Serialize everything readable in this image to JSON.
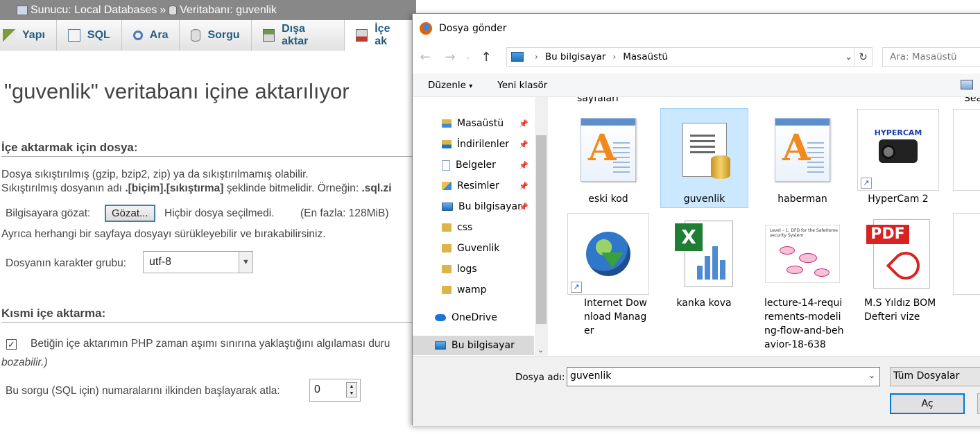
{
  "pma": {
    "breadcrumb": {
      "server": "Sunucu: Local Databases",
      "separator": "»",
      "database": "Veritabanı: guvenlik"
    },
    "tabs": [
      {
        "label": "Yapı",
        "icon": "structure-icon"
      },
      {
        "label": "SQL",
        "icon": "sql-icon"
      },
      {
        "label": "Ara",
        "icon": "search-icon"
      },
      {
        "label": "Sorgu",
        "icon": "query-icon"
      },
      {
        "label": "Dışa aktar",
        "icon": "export-icon"
      },
      {
        "label": "İçe ak",
        "icon": "import-icon"
      }
    ],
    "page_title": "\"guvenlik\" veritabanı içine aktarılıyor",
    "section_file": {
      "heading": "İçe aktarmak için dosya:",
      "line1": "Dosya sıkıştırılmış (gzip, bzip2, zip) ya da sıkıştırılmamış olabilir.",
      "line2_pre": "Sıkıştırılmış dosyanın adı ",
      "line2_bold": ".[biçim].[sıkıştırma]",
      "line2_post": " şeklinde bitmelidir. Örneğin: ",
      "line2_example": ".sql.zi",
      "browse_label": "Bilgisayara gözat:",
      "browse_button": "Gözat...",
      "no_file": "Hiçbir dosya seçilmedi.",
      "max_size": "(En fazla: 128MiB)",
      "drag_hint": "Ayrıca herhangi bir sayfaya dosyayı sürükleyebilir ve bırakabilirsiniz.",
      "charset_label": "Dosyanın karakter grubu:",
      "charset_value": "utf-8"
    },
    "section_partial": {
      "heading": "Kısmi içe aktarma:",
      "checkbox_label": "Betiğin içe aktarımın PHP zaman aşımı sınırına yaklaştığını algılaması duru",
      "checkbox_cont": "bozabilir.)",
      "skip_label": "Bu sorgu (SQL için) numaralarını ilkinden başlayarak atla:",
      "skip_value": "0"
    }
  },
  "dialog": {
    "title": "Dosya gönder",
    "address": [
      "Bu bilgisayar",
      "Masaüstü"
    ],
    "search_placeholder": "Ara: Masaüstü",
    "commands": {
      "organize": "Düzenle",
      "organize_arrow": "▾",
      "new_folder": "Yeni klasör"
    },
    "tree": [
      {
        "label": "Masaüstü",
        "icon": "desktop-folder-icon",
        "pinned": true
      },
      {
        "label": "İndirilenler",
        "icon": "downloads-folder-icon",
        "pinned": true
      },
      {
        "label": "Belgeler",
        "icon": "documents-folder-icon",
        "pinned": true
      },
      {
        "label": "Resimler",
        "icon": "pictures-folder-icon",
        "pinned": true
      },
      {
        "label": "Bu bilgisayar",
        "icon": "computer-icon",
        "pinned": true
      },
      {
        "label": "css",
        "icon": "folder-icon"
      },
      {
        "label": "Guvenlik",
        "icon": "folder-icon"
      },
      {
        "label": "logs",
        "icon": "folder-icon"
      },
      {
        "label": "wamp",
        "icon": "folder-icon"
      },
      {
        "label": "OneDrive",
        "icon": "onedrive-icon"
      },
      {
        "label": "Bu bilgisayar",
        "icon": "computer-icon",
        "selected": true
      }
    ],
    "files_partial_top": [
      "sayfaları",
      "Sear"
    ],
    "files": [
      {
        "name": "eski kod",
        "icon": "text-document-icon"
      },
      {
        "name": "guvenlik",
        "icon": "sql-file-icon",
        "selected": true
      },
      {
        "name": "haberman",
        "icon": "text-document-icon"
      },
      {
        "name": "HyperCam 2",
        "icon": "hypercam-shortcut-icon"
      },
      {
        "name": "Internet Download Manager",
        "icon": "idm-shortcut-icon"
      },
      {
        "name": "kanka kova",
        "icon": "excel-file-icon"
      },
      {
        "name": "lecture-14-requirements-modeling-flow-and-behavior-18-638",
        "icon": "image-thumbnail-icon"
      },
      {
        "name": "M.S Yıldız BOM Defteri vize",
        "icon": "pdf-file-icon"
      }
    ],
    "filename_label": "Dosya adı:",
    "filename_value": "guvenlik",
    "filter_value": "Tüm Dosyalar",
    "open_button": "Aç",
    "hypercam_logo": "HYPERCAM",
    "pdf_tag": "PDF",
    "lecture_header": "Level – 1: DFD for the SafeHome security System"
  }
}
